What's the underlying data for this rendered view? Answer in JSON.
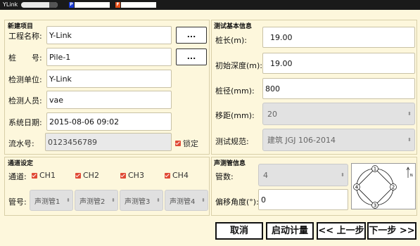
{
  "status_bar": {
    "app_name": "YLink",
    "p_tag": "P",
    "f_tag": "F"
  },
  "new_project": {
    "title": "新建项目",
    "project_name_label": "工程名称:",
    "project_name_value": "Y-Link",
    "pile_no_label": "桩　　号:",
    "pile_no_value": "Pile-1",
    "inspect_unit_label": "检测单位:",
    "inspect_unit_value": "Y-Link",
    "inspector_label": "检测人员:",
    "inspector_value": "vae",
    "system_date_label": "系统日期:",
    "system_date_value": "2015-08-06  09:02",
    "serial_label": "流水号:",
    "serial_value": "0123456789",
    "lock_label": "锁定",
    "dots": "..."
  },
  "test_basic": {
    "title": "测试基本信息",
    "pile_length_label": "桩长(m):",
    "pile_length_value": "19.00",
    "init_depth_label": "初始深度(m):",
    "init_depth_value": "19.00",
    "pile_diameter_label": "桩径(mm):",
    "pile_diameter_value": "800",
    "spacing_label": "移距(mm):",
    "spacing_value": "20",
    "standard_label": "测试规范:",
    "standard_value": "建筑 JGJ 106-2014"
  },
  "channel_setup": {
    "title": "通道设定",
    "channel_label": "通道:",
    "channels": [
      "CH1",
      "CH2",
      "CH3",
      "CH4"
    ],
    "tube_label": "管号:",
    "tubes": [
      "声测管1",
      "声测管2",
      "声测管3",
      "声测管4"
    ]
  },
  "tube_info": {
    "title": "声测管信息",
    "count_label": "管数:",
    "count_value": "4",
    "offset_label": "偏移角度(°):",
    "offset_value": "0",
    "diagram_labels": [
      "1",
      "2",
      "3",
      "4"
    ],
    "north_label": "N"
  },
  "actions": {
    "cancel": "取消",
    "start": "启动计量",
    "prev": "<< 上一步",
    "next": "下一步 >>"
  },
  "colors": {
    "background": "#fdf7dc",
    "check": "#e04a36",
    "p_tag": "#1a3bd6",
    "f_tag": "#e8501a"
  }
}
